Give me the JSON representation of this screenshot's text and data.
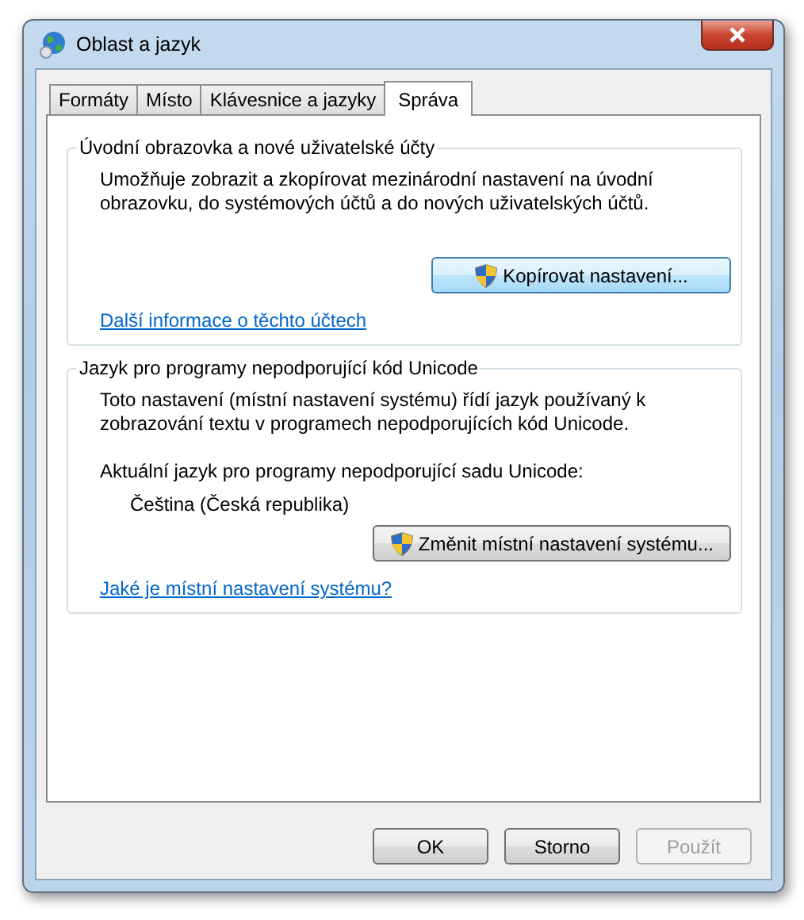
{
  "window": {
    "title": "Oblast a jazyk"
  },
  "tabs": [
    {
      "label": "Formáty",
      "selected": false
    },
    {
      "label": "Místo",
      "selected": false
    },
    {
      "label": "Klávesnice a jazyky",
      "selected": false
    },
    {
      "label": "Správa",
      "selected": true
    }
  ],
  "groups": [
    {
      "title": "Úvodní obrazovka a nové uživatelské účty",
      "description": "Umožňuje zobrazit a zkopírovat mezinárodní nastavení na úvodní obrazovku, do systémových účtů a do nových uživatelských účtů.",
      "button": {
        "label": "Kopírovat nastavení...",
        "focused": true
      },
      "link": "Další informace o těchto účtech"
    },
    {
      "title": "Jazyk pro programy nepodporující kód Unicode",
      "description": "Toto nastavení (místní nastavení systému) řídí jazyk používaný k zobrazování textu v programech nepodporujících kód Unicode.",
      "current_label": "Aktuální jazyk pro programy nepodporující sadu Unicode:",
      "current_value": "Čeština (Česká republika)",
      "button": {
        "label": "Změnit místní nastavení systému...",
        "focused": false
      },
      "link": "Jaké je místní nastavení systému?"
    }
  ],
  "buttons": [
    {
      "label": "OK",
      "disabled": false
    },
    {
      "label": "Storno",
      "disabled": false
    },
    {
      "label": "Použít",
      "disabled": true
    }
  ]
}
